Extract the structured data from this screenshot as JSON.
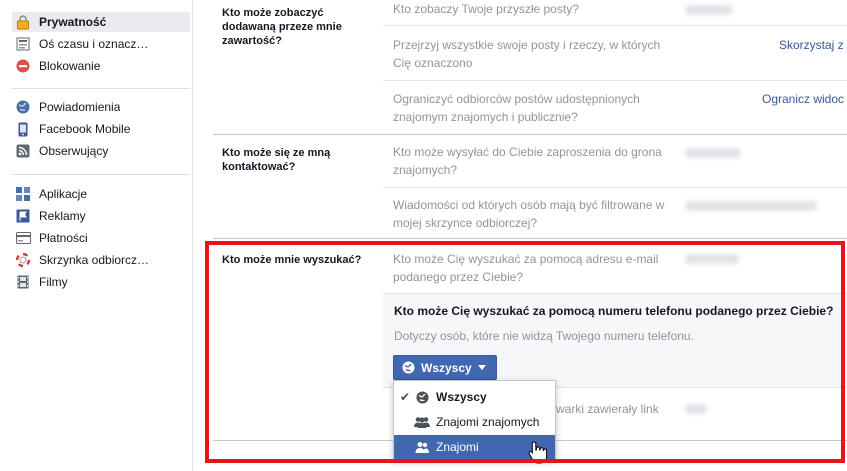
{
  "sidebar": {
    "items": [
      {
        "label": "Prywatność",
        "icon": "lock-icon",
        "active": true
      },
      {
        "label": "Oś czasu i oznacz…",
        "icon": "timeline-icon"
      },
      {
        "label": "Blokowanie",
        "icon": "block-icon"
      },
      {
        "label": "Powiadomienia",
        "icon": "globe-notifications-icon"
      },
      {
        "label": "Facebook Mobile",
        "icon": "mobile-phone-icon"
      },
      {
        "label": "Obserwujący",
        "icon": "rss-icon"
      },
      {
        "label": "Aplikacje",
        "icon": "apps-icon"
      },
      {
        "label": "Reklamy",
        "icon": "ads-flag-icon"
      },
      {
        "label": "Płatności",
        "icon": "payments-card-icon"
      },
      {
        "label": "Skrzynka odbiorcz…",
        "icon": "lifebuoy-icon"
      },
      {
        "label": "Filmy",
        "icon": "film-icon"
      }
    ]
  },
  "sections": {
    "content": {
      "question": "Kto może zobaczyć dodawaną przeze mnie zawartość?",
      "sub1": "Kto zobaczy Twoje przyszłe posty?",
      "sub2": "Przejrzyj wszystkie swoje posty i rzeczy, w których Cię oznaczono",
      "sub2_link": "Skorzystaj z",
      "sub3": "Ograniczyć odbiorców postów udostępnionych znajomym znajomych i publicznie?",
      "sub3_link": "Ogranicz widoc"
    },
    "contact": {
      "question": "Kto może się ze mną kontaktować?",
      "sub1": "Kto może wysyłać do Ciebie zaproszenia do grona znajomych?",
      "sub2": "Wiadomości od których osób mają być filtrowane w mojej skrzynce odbiorczej?"
    },
    "lookup": {
      "question": "Kto może mnie wyszukać?",
      "sub1": "Kto może Cię wyszukać za pomocą adresu e-mail podanego przez Ciebie?",
      "panel_title": "Kto może Cię wyszukać za pomocą numeru telefonu podanego przez Ciebie?",
      "panel_desc": "Dotyczy osób, które nie widzą Twojego numeru telefonu.",
      "audience_button": "Wszyscy",
      "sub3_tail": "warki zawierały link"
    }
  },
  "dropdown": {
    "options": [
      {
        "label": "Wszyscy",
        "selected": true,
        "icon": "globe-icon"
      },
      {
        "label": "Znajomi znajomych",
        "icon": "friends-of-friends-icon"
      },
      {
        "label": "Znajomi",
        "icon": "friends-icon",
        "hover": true
      }
    ]
  },
  "colors": {
    "accent": "#4267b2",
    "highlight": "#e8141b",
    "link": "#365899"
  }
}
